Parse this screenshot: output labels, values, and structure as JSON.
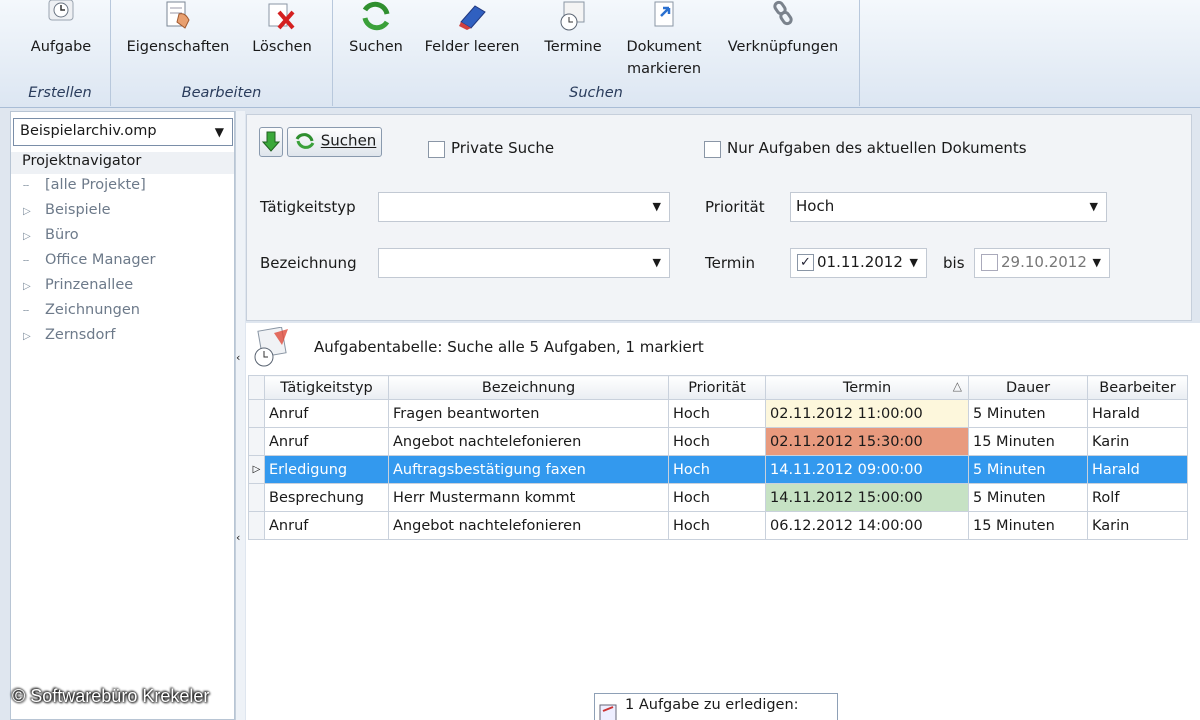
{
  "ribbon": {
    "groups": [
      {
        "label": "Erstellen",
        "buttons": [
          {
            "label": "Aufgabe"
          }
        ]
      },
      {
        "label": "Bearbeiten",
        "buttons": [
          {
            "label": "Eigenschaften"
          },
          {
            "label": "Löschen"
          }
        ]
      },
      {
        "label": "Suchen",
        "buttons": [
          {
            "label": "Suchen"
          },
          {
            "label": "Felder leeren"
          },
          {
            "label": "Termine"
          },
          {
            "label": "Dokument markieren"
          },
          {
            "label": "Verknüpfungen"
          }
        ]
      }
    ],
    "icons": [
      "clock-icon",
      "properties-hand-icon",
      "delete-x-icon",
      "search-arrows-icon",
      "eraser-icon",
      "calendar-clock-icon",
      "document-mark-icon",
      "chain-link-icon"
    ]
  },
  "sidebar": {
    "archive": "Beispielarchiv.omp",
    "title": "Projektnavigator",
    "items": [
      {
        "label": "[alle Projekte]",
        "expandable": false
      },
      {
        "label": "Beispiele",
        "expandable": true
      },
      {
        "label": "Büro",
        "expandable": true
      },
      {
        "label": "Office Manager",
        "expandable": false
      },
      {
        "label": "Prinzenallee",
        "expandable": true
      },
      {
        "label": "Zeichnungen",
        "expandable": false
      },
      {
        "label": "Zernsdorf",
        "expandable": true
      }
    ]
  },
  "search": {
    "button_label": "Suchen",
    "private_label": "Private Suche",
    "private_checked": false,
    "current_doc_label": "Nur Aufgaben des aktuellen Dokuments",
    "current_doc_checked": false,
    "type_label": "Tätigkeitstyp",
    "type_value": "",
    "name_label": "Bezeichnung",
    "name_value": "",
    "priority_label": "Priorität",
    "priority_value": "Hoch",
    "date_label": "Termin",
    "date_from": "01.11.2012",
    "date_from_checked": true,
    "bis_label": "bis",
    "date_to": "29.10.2012",
    "date_to_checked": false
  },
  "table": {
    "caption": "Aufgabentabelle: Suche alle 5 Aufgaben, 1 markiert",
    "columns": [
      "Tätigkeitstyp",
      "Bezeichnung",
      "Priorität",
      "Termin",
      "Dauer",
      "Bearbeiter"
    ],
    "sort_indicator": "△",
    "rows": [
      {
        "type": "Anruf",
        "name": "Fragen beantworten",
        "priority": "Hoch",
        "date": "02.11.2012 11:00:00",
        "duration": "5 Minuten",
        "editor": "Harald",
        "date_color": "#fdf7dc",
        "selected": false
      },
      {
        "type": "Anruf",
        "name": "Angebot nachtelefonieren",
        "priority": "Hoch",
        "date": "02.11.2012 15:30:00",
        "duration": "15 Minuten",
        "editor": "Karin",
        "date_color": "#e89a7e",
        "selected": false
      },
      {
        "type": "Erledigung",
        "name": "Auftragsbestätigung faxen",
        "priority": "Hoch",
        "date": "14.11.2012 09:00:00",
        "duration": "5 Minuten",
        "editor": "Harald",
        "date_color": "",
        "selected": true
      },
      {
        "type": "Besprechung",
        "name": "Herr Mustermann kommt",
        "priority": "Hoch",
        "date": "14.11.2012 15:00:00",
        "duration": "5 Minuten",
        "editor": "Rolf",
        "date_color": "#c6e2c4",
        "selected": false
      },
      {
        "type": "Anruf",
        "name": "Angebot nachtelefonieren",
        "priority": "Hoch",
        "date": "06.12.2012 14:00:00",
        "duration": "15 Minuten",
        "editor": "Karin",
        "date_color": "",
        "selected": false
      }
    ]
  },
  "notification": "1 Aufgabe zu erledigen:",
  "copyright": "© Softwarebüro Krekeler"
}
